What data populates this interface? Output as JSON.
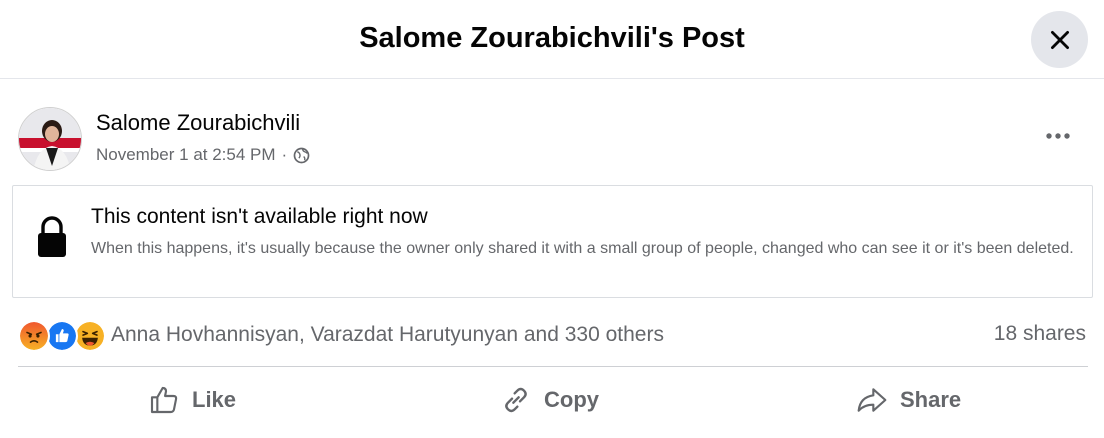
{
  "dialog": {
    "title": "Salome Zourabichvili's Post",
    "close_icon": "close-icon"
  },
  "post": {
    "author": "Salome Zourabichvili",
    "timestamp": "November 1 at 2:54 PM",
    "separator": "·",
    "privacy_icon": "globe-icon",
    "more_icon": "more-horizontal-icon"
  },
  "unavailable": {
    "icon": "lock-icon",
    "title": "This content isn't available right now",
    "description": "When this happens, it's usually because the owner only shared it with a small group of people, changed who can see it or it's been deleted."
  },
  "reactions": {
    "icons": [
      "angry-reaction-icon",
      "like-reaction-icon",
      "haha-reaction-icon"
    ],
    "names_text": "Anna Hovhannisyan, Varazdat Harutyunyan and 330 others",
    "shares_text": "18 shares"
  },
  "actions": {
    "like_label": "Like",
    "copy_label": "Copy",
    "share_label": "Share"
  },
  "colors": {
    "text_primary": "#050505",
    "text_secondary": "#65676b",
    "close_bg": "#e4e6eb",
    "like_blue": "#1877f2",
    "angry_orange": "#e9710f",
    "haha_yellow": "#f7b125"
  }
}
